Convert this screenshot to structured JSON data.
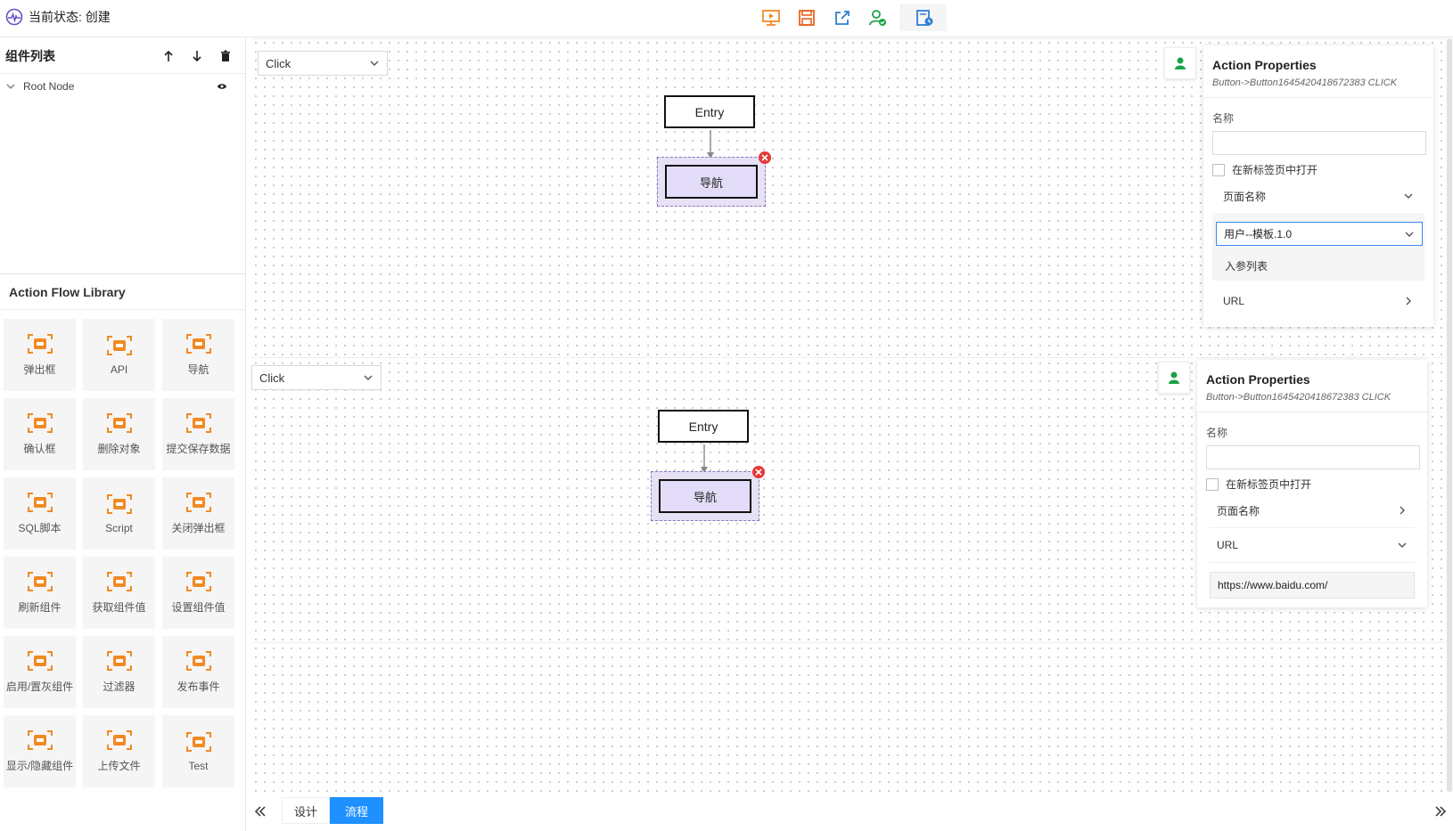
{
  "header": {
    "status_text": "当前状态: 创建",
    "toolbar": [
      {
        "icon": "preview-icon",
        "color": "#f08a24"
      },
      {
        "icon": "save-icon",
        "color": "#e8641e"
      },
      {
        "icon": "export-icon",
        "color": "#2f7fd6"
      },
      {
        "icon": "publish-user-icon",
        "color": "#1aa34a"
      },
      {
        "icon": "history-doc-icon",
        "color": "#2f7fd6"
      }
    ]
  },
  "left_panel": {
    "components_title": "组件列表",
    "tree": [
      {
        "label": "Root Node"
      }
    ],
    "library_title": "Action Flow Library",
    "library_items": [
      {
        "label": "弹出框",
        "icon": "popup-icon"
      },
      {
        "label": "API",
        "icon": "api-icon"
      },
      {
        "label": "导航",
        "icon": "navigate-icon"
      },
      {
        "label": "确认框",
        "icon": "confirm-icon"
      },
      {
        "label": "删除对象",
        "icon": "delete-object-icon"
      },
      {
        "label": "提交保存数据",
        "icon": "submit-save-icon"
      },
      {
        "label": "SQL脚本",
        "icon": "sql-script-icon"
      },
      {
        "label": "Script",
        "icon": "script-icon"
      },
      {
        "label": "关闭弹出框",
        "icon": "close-popup-icon"
      },
      {
        "label": "刷新组件",
        "icon": "refresh-icon"
      },
      {
        "label": "获取组件值",
        "icon": "get-value-icon"
      },
      {
        "label": "设置组件值",
        "icon": "set-value-icon"
      },
      {
        "label": "启用/置灰组件",
        "icon": "toggle-icon"
      },
      {
        "label": "过滤器",
        "icon": "filter-icon"
      },
      {
        "label": "发布事件",
        "icon": "publish-event-icon"
      },
      {
        "label": "显示/隐藏组件",
        "icon": "show-hide-icon"
      },
      {
        "label": "上传文件",
        "icon": "upload-icon"
      },
      {
        "label": "Test",
        "icon": "test-icon"
      }
    ],
    "icon_color": "#f08a24"
  },
  "flows": [
    {
      "event_select": "Click",
      "entry_label": "Entry",
      "node_label": "导航",
      "props": {
        "title": "Action Properties",
        "subtitle": "Button->Button1645420418672383 CLICK",
        "name_label": "名称",
        "name_value": "",
        "new_tab_label": "在新标签页中打开",
        "page_name_label": "页面名称",
        "page_select_value": "用户--模板.1.0",
        "params_label": "入参列表",
        "url_label": "URL"
      }
    },
    {
      "event_select": "Click",
      "entry_label": "Entry",
      "node_label": "导航",
      "props": {
        "title": "Action Properties",
        "subtitle": "Button->Button1645420418672383 CLICK",
        "name_label": "名称",
        "name_value": "",
        "new_tab_label": "在新标签页中打开",
        "page_name_label": "页面名称",
        "url_label": "URL",
        "url_value": "https://www.baidu.com/"
      }
    }
  ],
  "bottom": {
    "tabs": [
      {
        "label": "设计",
        "active": false
      },
      {
        "label": "流程",
        "active": true
      }
    ],
    "active_color": "#1e90ff"
  }
}
